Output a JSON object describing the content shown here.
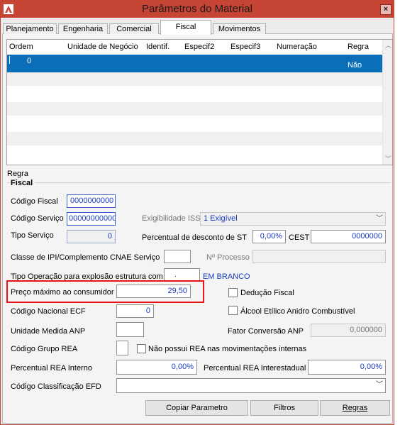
{
  "window": {
    "title": "Parâmetros do Material",
    "close": "×"
  },
  "tabs": [
    "Planejamento",
    "Engenharia",
    "Comercial",
    "Fiscal",
    "Movimentos"
  ],
  "grid": {
    "columns": [
      "Ordem",
      "Unidade de Negócio",
      "Identif.",
      "Especif2",
      "Especif3",
      "Numeração",
      "Regra"
    ],
    "selected_row": {
      "ordem": "0",
      "regra": "Não"
    }
  },
  "section": {
    "regra": "Regra",
    "fiscal": "Fiscal"
  },
  "fields": {
    "codigo_fiscal": {
      "label": "Código Fiscal",
      "value": "0000000000"
    },
    "codigo_servico": {
      "label": "Código Serviço",
      "value": "00000000000"
    },
    "exigibilidade_iss": {
      "label": "Exigibilidade ISS",
      "value": "1 Exigível"
    },
    "tipo_servico": {
      "label": "Tipo Serviço",
      "value": "0"
    },
    "percentual_desconto_st": {
      "label": "Percentual de desconto de ST",
      "value": "0,00%"
    },
    "cest": {
      "label": "CEST",
      "value": "0000000"
    },
    "classe_ipi": {
      "label": "Classe de IPI/Complemento CNAE Serviço",
      "value": ""
    },
    "n_processo": {
      "label": "Nº Processo",
      "value": ""
    },
    "tipo_operacao": {
      "label": "Tipo Operação para explosão estrutura com.",
      "value": ".",
      "status": "EM BRANCO"
    },
    "preco_maximo": {
      "label": "Preço máximo ao consumidor",
      "value": "29,50"
    },
    "deducao_fiscal": {
      "label": "Dedução Fiscal"
    },
    "codigo_nacional_ecf": {
      "label": "Código Nacional ECF",
      "value": "0"
    },
    "alcool_etilico": {
      "label": "Álcool Etílico Anidro Combustível"
    },
    "unidade_medida_anp": {
      "label": "Unidade Medida ANP",
      "value": ""
    },
    "fator_conversao_anp": {
      "label": "Fator Conversão ANP",
      "value": "0,000000"
    },
    "codigo_grupo_rea": {
      "label": "Código Grupo REA",
      "value": ""
    },
    "nao_possui_rea": {
      "label": "Não possui REA nas movimentações internas"
    },
    "percentual_rea_interno": {
      "label": "Percentual REA Interno",
      "value": "0,00%"
    },
    "percentual_rea_interestadual": {
      "label": "Percentual REA Interestadual",
      "value": "0,00%"
    },
    "codigo_classificacao_efd": {
      "label": "Código Classificação EFD",
      "value": ""
    }
  },
  "buttons": {
    "copiar": "Copiar Parametro",
    "filtros": "Filtros",
    "regras": "Regras"
  },
  "colors": {
    "titlebar": "#c64434",
    "selection": "#0a6eb8",
    "highlight": "#e5141b"
  }
}
